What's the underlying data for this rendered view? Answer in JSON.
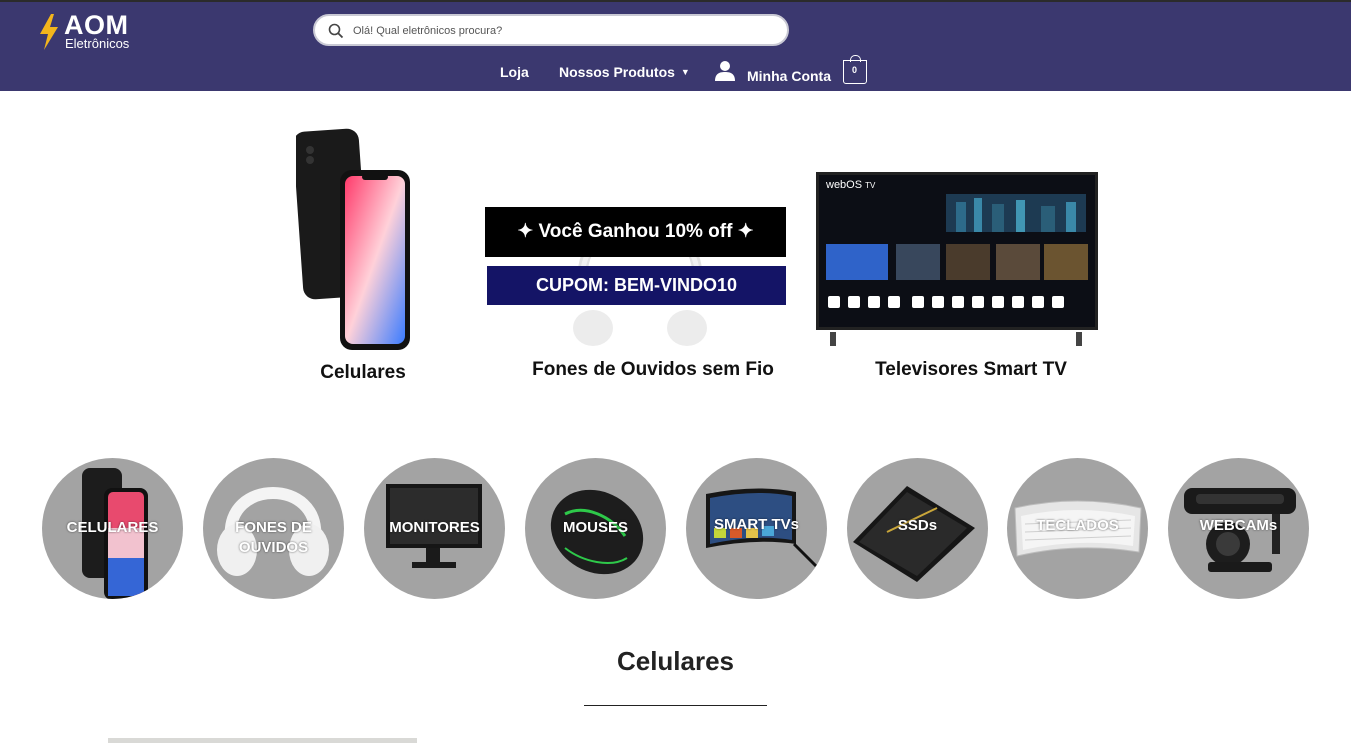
{
  "header": {
    "logo_brand": "AOM",
    "logo_sub": "Eletrônicos",
    "search_placeholder": "Olá! Qual eletrônicos procura?",
    "nav": {
      "loja": "Loja",
      "produtos": "Nossos Produtos",
      "conta": "Minha Conta",
      "cart_count": "0"
    },
    "colors": {
      "bar": "#3b386f",
      "logo_bolt": "#f3b51c"
    }
  },
  "features": [
    {
      "label": "Celulares",
      "icon": "phone-image"
    },
    {
      "label": "Fones de Ouvidos sem Fio",
      "icon": "headphones-image"
    },
    {
      "label": "Televisores Smart TV",
      "icon": "tv-image"
    }
  ],
  "promo": {
    "title": "✦ Você Ganhou 10% off ✦",
    "code": "CUPOM: BEM-VINDO10"
  },
  "tv_screen": {
    "brand": "webOS",
    "suffix": "TV"
  },
  "categories": [
    {
      "label": "CELULARES"
    },
    {
      "label": "FONES DE OUVIDOS"
    },
    {
      "label": "MONITORES"
    },
    {
      "label": "MOUSES"
    },
    {
      "label": "SMART TVs"
    },
    {
      "label": "SSDs"
    },
    {
      "label": "TECLADOS"
    },
    {
      "label": "WEBCAMs"
    }
  ],
  "section": {
    "title": "Celulares"
  }
}
